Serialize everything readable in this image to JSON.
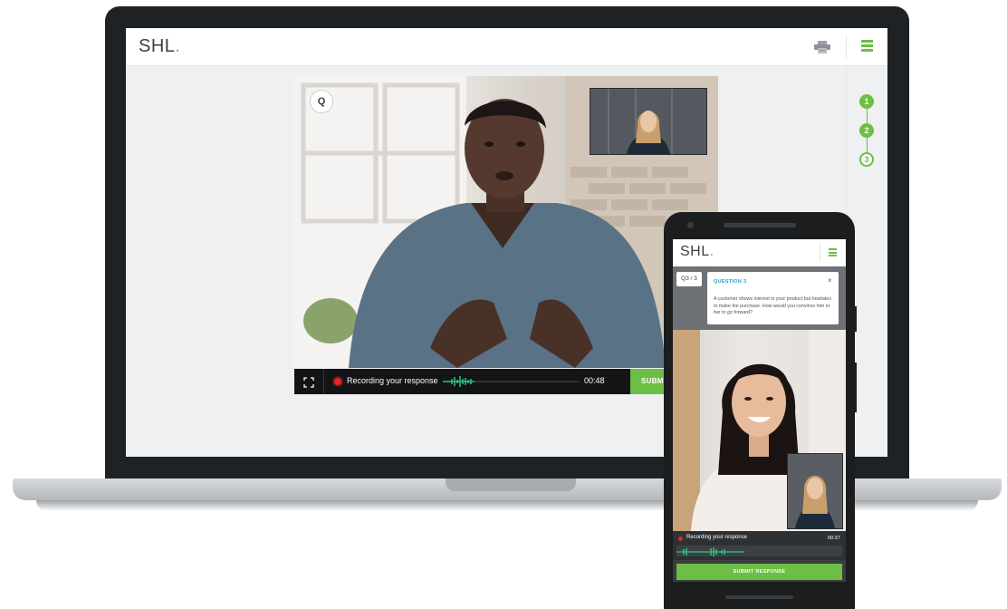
{
  "desktop": {
    "logo": {
      "text": "SHL",
      "dot": "."
    },
    "header": {
      "print_icon": "print-icon",
      "menu_icon": "hamburger-menu-icon"
    },
    "steps": [
      {
        "label": "1",
        "state": "done"
      },
      {
        "label": "2",
        "state": "done"
      },
      {
        "label": "3",
        "state": "current"
      }
    ],
    "video": {
      "question_badge": "Q",
      "recording_label": "Recording your response",
      "recording_time": "00:48",
      "submit_label": "SUBMI",
      "fullscreen_icon": "fullscreen-icon"
    }
  },
  "mobile": {
    "logo": {
      "text": "SHL",
      "dot": "."
    },
    "menu_icon": "hamburger-menu-icon",
    "question_counter": "Q3 / 3",
    "question_title": "QUESTION 3",
    "close_icon": "close-icon",
    "question_text": "A customer shows interest in your product but hesitates to make the purchase. How would you convince him or her to go forward?",
    "recording_label": "Recording your response",
    "recording_time": "00:37",
    "submit_label": "SUBMIT RESPONSE"
  },
  "colors": {
    "accent_green": "#6cbe45",
    "recording_red": "#e3262b",
    "question_blue": "#2f9fc4",
    "dark_bezel": "#1f2224"
  }
}
